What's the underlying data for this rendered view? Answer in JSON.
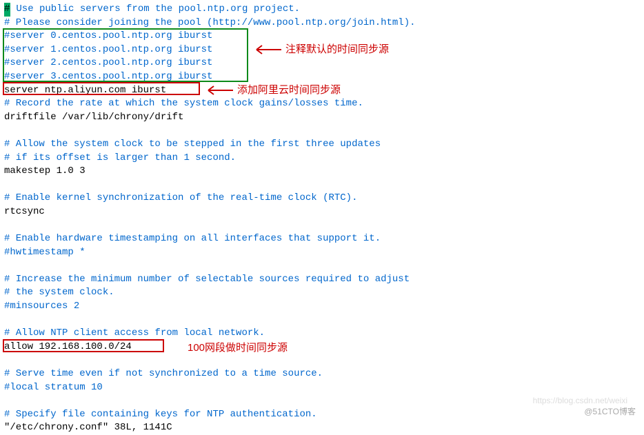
{
  "lines": [
    {
      "text": "# Use public servers from the pool.ntp.org project.",
      "cls": "comment",
      "cursor": true
    },
    {
      "text": "# Please consider joining the pool (http://www.pool.ntp.org/join.html).",
      "cls": "comment"
    },
    {
      "text": "#server 0.centos.pool.ntp.org iburst",
      "cls": "comment"
    },
    {
      "text": "#server 1.centos.pool.ntp.org iburst",
      "cls": "comment"
    },
    {
      "text": "#server 2.centos.pool.ntp.org iburst",
      "cls": "comment"
    },
    {
      "text": "#server 3.centos.pool.ntp.org iburst",
      "cls": "comment"
    },
    {
      "text": "server ntp.aliyun.com iburst",
      "cls": "normal"
    },
    {
      "text": "# Record the rate at which the system clock gains/losses time.",
      "cls": "comment"
    },
    {
      "text": "driftfile /var/lib/chrony/drift",
      "cls": "normal"
    },
    {
      "text": "",
      "cls": "normal"
    },
    {
      "text": "# Allow the system clock to be stepped in the first three updates",
      "cls": "comment"
    },
    {
      "text": "# if its offset is larger than 1 second.",
      "cls": "comment"
    },
    {
      "text": "makestep 1.0 3",
      "cls": "normal"
    },
    {
      "text": "",
      "cls": "normal"
    },
    {
      "text": "# Enable kernel synchronization of the real-time clock (RTC).",
      "cls": "comment"
    },
    {
      "text": "rtcsync",
      "cls": "normal"
    },
    {
      "text": "",
      "cls": "normal"
    },
    {
      "text": "# Enable hardware timestamping on all interfaces that support it.",
      "cls": "comment"
    },
    {
      "text": "#hwtimestamp *",
      "cls": "comment"
    },
    {
      "text": "",
      "cls": "normal"
    },
    {
      "text": "# Increase the minimum number of selectable sources required to adjust",
      "cls": "comment"
    },
    {
      "text": "# the system clock.",
      "cls": "comment"
    },
    {
      "text": "#minsources 2",
      "cls": "comment"
    },
    {
      "text": "",
      "cls": "normal"
    },
    {
      "text": "# Allow NTP client access from local network.",
      "cls": "comment"
    },
    {
      "text": "allow 192.168.100.0/24",
      "cls": "normal"
    },
    {
      "text": "",
      "cls": "normal"
    },
    {
      "text": "# Serve time even if not synchronized to a time source.",
      "cls": "comment"
    },
    {
      "text": "#local stratum 10",
      "cls": "comment"
    },
    {
      "text": "",
      "cls": "normal"
    },
    {
      "text": "# Specify file containing keys for NTP authentication.",
      "cls": "comment"
    },
    {
      "text": "\"/etc/chrony.conf\" 38L, 1141C",
      "cls": "normal"
    }
  ],
  "annotations": {
    "a1": "注释默认的时间同步源",
    "a2": "添加阿里云时间同步源",
    "a3": "100网段做时间同步源"
  },
  "watermark": {
    "url": "https://blog.csdn.net/weixi",
    "credit": "@51CTO博客"
  }
}
